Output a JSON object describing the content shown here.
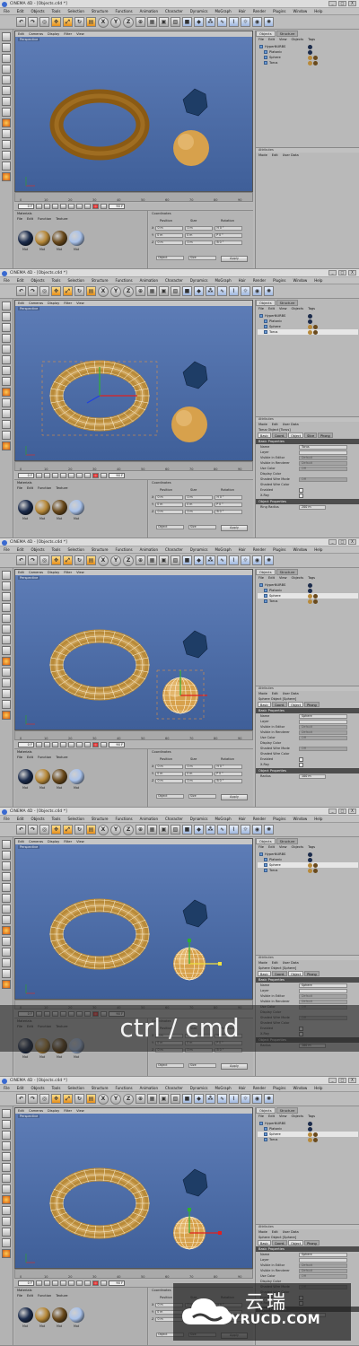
{
  "window": {
    "title": "CINEMA 4D - [Objects.c4d *]",
    "buttons": [
      "_",
      "□",
      "X"
    ]
  },
  "menubar": [
    "File",
    "Edit",
    "Objects",
    "Tools",
    "Selection",
    "Structure",
    "Functions",
    "Animation",
    "Character",
    "Dynamics",
    "MoGraph",
    "Hair",
    "Render",
    "Plugins",
    "Window",
    "Help"
  ],
  "toolbar": {
    "x_label": "X",
    "y_label": "Y",
    "z_label": "Z"
  },
  "viewport": {
    "menu": [
      "Edit",
      "Cameras",
      "Display",
      "Filter",
      "View"
    ],
    "label": "Perspective"
  },
  "timeline": {
    "ticks": [
      "0",
      "10",
      "20",
      "30",
      "40",
      "50",
      "60",
      "70",
      "80",
      "90"
    ],
    "start_frame": "0 F",
    "current_frame": "90 F",
    "end_frame": "0 F"
  },
  "materials": {
    "title": "Materials",
    "menu": [
      "File",
      "Edit",
      "Function",
      "Texture"
    ],
    "items": [
      {
        "label": "Mat",
        "color": "#1c2c4c"
      },
      {
        "label": "Mat",
        "color": "#b88a3a"
      },
      {
        "label": "Mat",
        "color": "#6a4a1c"
      },
      {
        "label": "Mat",
        "color": "#a9c2ea"
      }
    ]
  },
  "coordinates": {
    "title": "Coordinates",
    "columns": [
      "Position",
      "Size",
      "Rotation"
    ],
    "rows": [
      {
        "axis": "X",
        "pos": "0 m",
        "size": "0 m",
        "rot": "H 0 °"
      },
      {
        "axis": "Y",
        "pos": "0 m",
        "size": "0 m",
        "rot": "P 0 °"
      },
      {
        "axis": "Z",
        "pos": "0 m",
        "size": "0 m",
        "rot": "B 0 °"
      }
    ],
    "mode_object": "Object",
    "mode_size": "Size",
    "apply": "Apply"
  },
  "objects": {
    "tabs": [
      "Objects",
      "Structure"
    ],
    "menu": [
      "File",
      "Edit",
      "View",
      "Objects",
      "Tags"
    ],
    "items": [
      "HyperNURBS",
      "Platonic",
      "Sphere",
      "Torus"
    ]
  },
  "attributes": {
    "tab": "Attributes",
    "menu": [
      "Mode",
      "Edit",
      "User Data"
    ],
    "torus_title": "Torus Object [Torus]",
    "sphere_title": "Sphere Object [Sphere]",
    "tabs": [
      "Basic",
      "Coord.",
      "Object",
      "Slice",
      "Phong"
    ],
    "basic_section": "Basic Properties",
    "object_section": "Object Properties",
    "rows": [
      "Name",
      "Layer",
      "Visible in Editor",
      "Visible in Renderer",
      "Use Color",
      "Display Color",
      "Shaded Wire Mode",
      "Shaded Wire Color",
      "Enabled",
      "X-Ray"
    ],
    "values": {
      "name_torus": "Torus",
      "name_sphere": "Sphere",
      "vis_editor": "Default",
      "vis_render": "Default",
      "use_color": "Off",
      "wire_mode": "Off"
    },
    "ring_radius_label": "Ring Radius",
    "ring_radius_value": "200 m",
    "radius_label": "Radius",
    "radius_value": "100 m"
  },
  "colors": {
    "viewport_top": "#5e7db7",
    "viewport_bottom": "#3f5f99",
    "torus": "#8a5a14",
    "sphere": "#d7a14c",
    "platonic": "#1e3d66"
  },
  "caption": "ctrl / cmd",
  "watermark": {
    "zh": "云瑞",
    "en": "YRUCD.COM"
  }
}
